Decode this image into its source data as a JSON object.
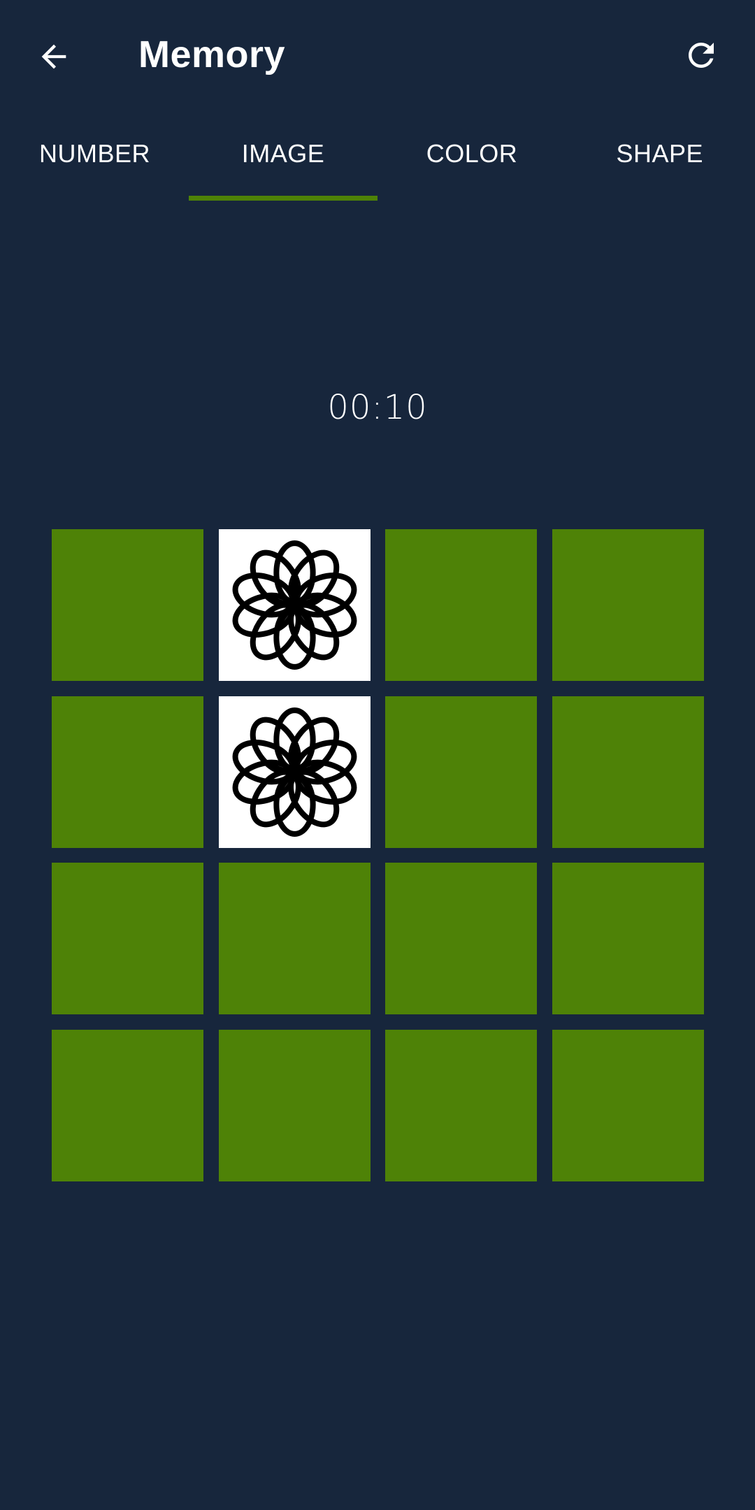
{
  "app_bar": {
    "title": "Memory",
    "back_icon": "arrow-left-icon",
    "refresh_icon": "refresh-icon"
  },
  "tabs": [
    {
      "label": "NUMBER",
      "selected": false
    },
    {
      "label": "IMAGE",
      "selected": true
    },
    {
      "label": "COLOR",
      "selected": false
    },
    {
      "label": "SHAPE",
      "selected": false
    }
  ],
  "timer": "00:10",
  "board": {
    "rows": 4,
    "cols": 4,
    "card_back_color": "#4e8207",
    "revealed_cards": [
      {
        "row": 0,
        "col": 1,
        "image": "flower-icon"
      },
      {
        "row": 1,
        "col": 1,
        "image": "flower-icon"
      }
    ]
  },
  "colors": {
    "background": "#17263c",
    "accent": "#4e8207",
    "text": "#ffffff"
  }
}
